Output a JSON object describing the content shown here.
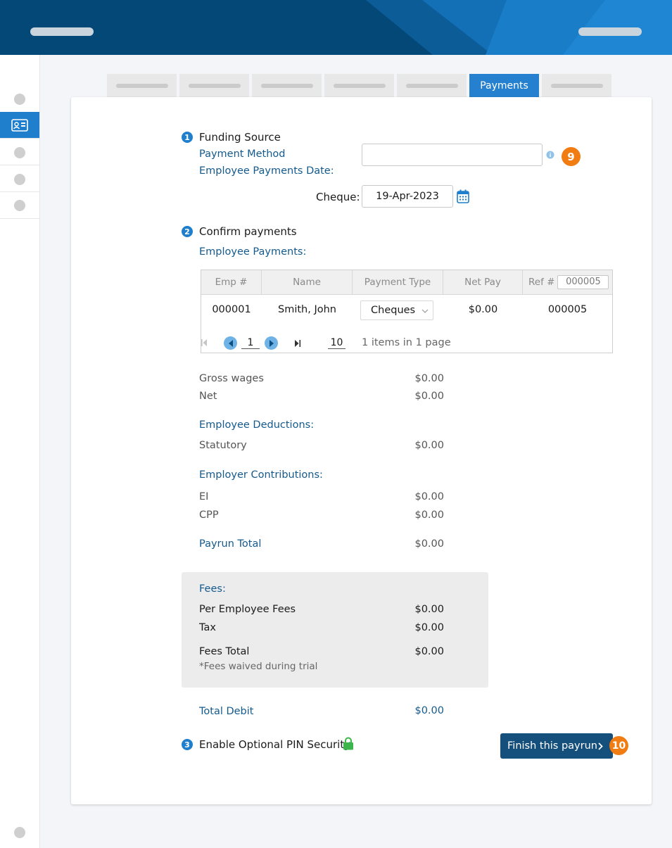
{
  "tabs": {
    "active_label": "Payments"
  },
  "funding": {
    "step": "1",
    "title": "Funding Source",
    "payment_method_label": "Payment Method",
    "payments_date_label": "Employee Payments Date:",
    "cheque_label": "Cheque:",
    "cheque_date": "19-Apr-2023",
    "badge": "9"
  },
  "confirm": {
    "step": "2",
    "title": "Confirm payments",
    "employee_payments_label": "Employee Payments:",
    "columns": [
      "Emp #",
      "Name",
      "Payment Type",
      "Net Pay",
      "Ref #"
    ],
    "ref_input_value": "000005",
    "rows": [
      {
        "emp": "000001",
        "name": "Smith, John",
        "payment_type": "Cheques",
        "net_pay": "$0.00",
        "ref": "000005"
      }
    ],
    "pager": {
      "page": "1",
      "page_size": "10",
      "info": "1 items in 1 page"
    }
  },
  "summary": {
    "gross_wages_label": "Gross wages",
    "gross_wages": "$0.00",
    "net_label": "Net",
    "net": "$0.00",
    "deductions_label": "Employee Deductions:",
    "statutory_label": "Statutory",
    "statutory": "$0.00",
    "contributions_label": "Employer Contributions:",
    "ei_label": "EI",
    "ei": "$0.00",
    "cpp_label": "CPP",
    "cpp": "$0.00",
    "payrun_total_label": "Payrun Total",
    "payrun_total": "$0.00"
  },
  "fees": {
    "title": "Fees:",
    "per_employee_label": "Per Employee Fees",
    "per_employee": "$0.00",
    "tax_label": "Tax",
    "tax": "$0.00",
    "total_label": "Fees Total",
    "total": "$0.00",
    "note": "*Fees waived during trial"
  },
  "total_debit_label": "Total Debit",
  "total_debit": "$0.00",
  "pin": {
    "step": "3",
    "label": "Enable Optional PIN Security"
  },
  "finish": {
    "label": "Finish this payrun",
    "badge": "10"
  },
  "colors": {
    "header": "#034877",
    "accent": "#1f7fcc",
    "link": "#145a8d",
    "badge": "#f07c12",
    "lock": "#3cb54a",
    "button": "#154f7c"
  },
  "icons": [
    "id-card-icon",
    "calendar-icon",
    "info-icon",
    "first-page-icon",
    "prev-page-icon",
    "next-page-icon",
    "last-page-icon",
    "chevron-down-icon",
    "lock-icon",
    "chevron-right-icon"
  ]
}
